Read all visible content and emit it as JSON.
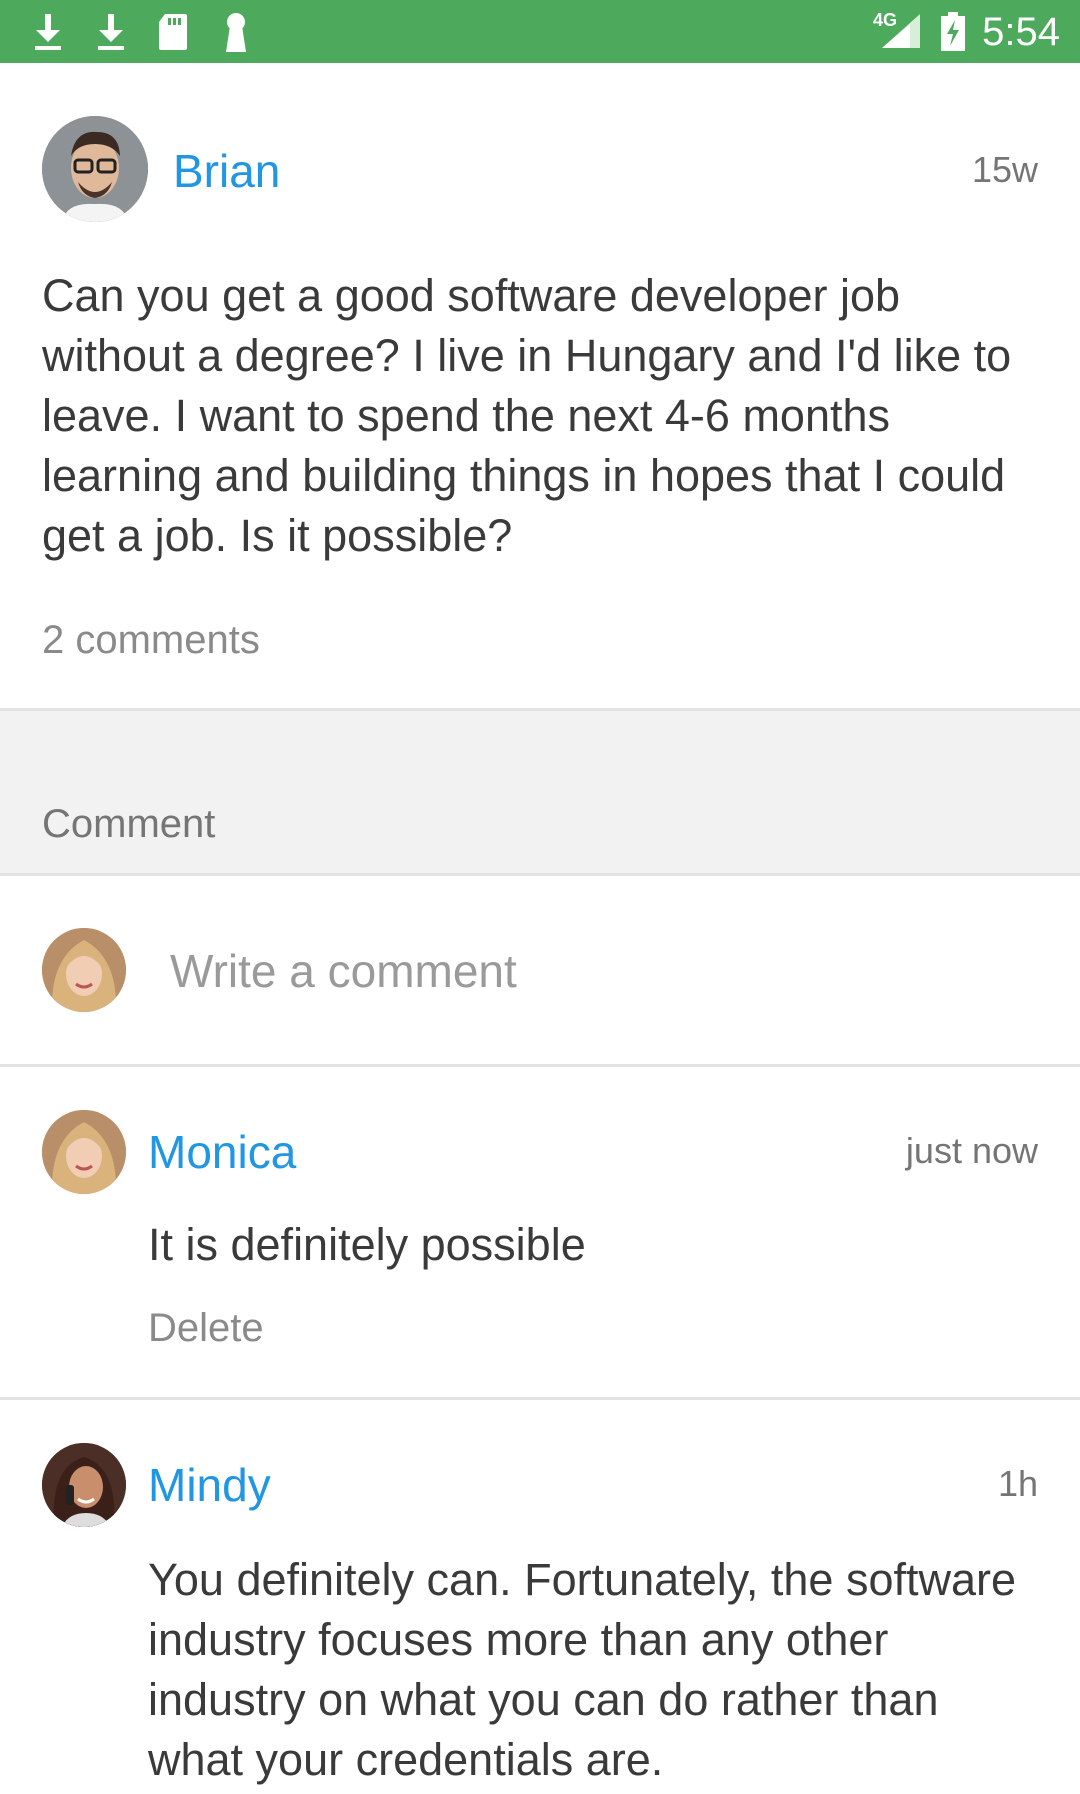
{
  "status_bar": {
    "time": "5:54",
    "network": "4G",
    "icons": [
      "download-icon",
      "download-icon",
      "sd-card-icon",
      "keyhole-icon",
      "signal-icon",
      "battery-charging-icon"
    ]
  },
  "post": {
    "author": "Brian",
    "time": "15w",
    "text": "Can you get a good software developer job without a degree? I live in Hungary and I'd like to leave. I want to spend the next 4-6 months learning and building things in hopes that I could get a job. Is it possible?",
    "comments_count": "2 comments"
  },
  "section": {
    "title": "Comment"
  },
  "composer": {
    "placeholder": "Write a comment"
  },
  "comments": [
    {
      "author": "Monica",
      "time": "just now",
      "text": "It is definitely possible",
      "delete_label": "Delete"
    },
    {
      "author": "Mindy",
      "time": "1h",
      "text": "You definitely can. Fortunately, the software industry focuses more than any other industry on what you can do rather than what your credentials are."
    }
  ],
  "colors": {
    "status_bar": "#4daa5c",
    "link": "#2196e3",
    "muted": "#8a8a8a"
  }
}
